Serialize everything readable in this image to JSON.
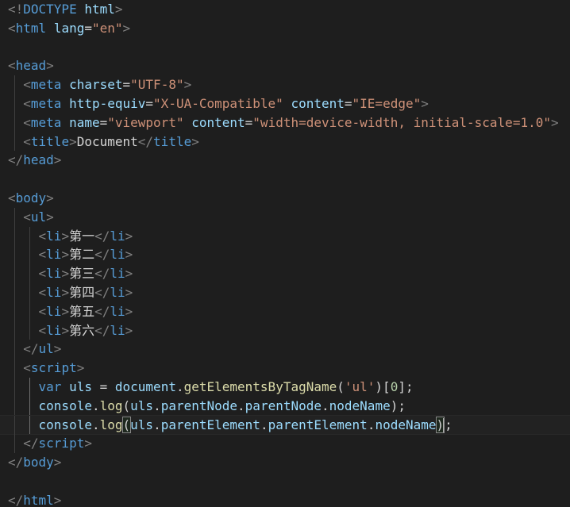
{
  "editor": {
    "lines": [
      [
        {
          "c": "t-punc",
          "t": "<!"
        },
        {
          "c": "t-tag",
          "t": "DOCTYPE "
        },
        {
          "c": "t-attr",
          "t": "html"
        },
        {
          "c": "t-punc",
          "t": ">"
        }
      ],
      [
        {
          "c": "t-punc",
          "t": "<"
        },
        {
          "c": "t-tag",
          "t": "html "
        },
        {
          "c": "t-attr",
          "t": "lang"
        },
        {
          "c": "t-text",
          "t": "="
        },
        {
          "c": "t-str",
          "t": "\"en\""
        },
        {
          "c": "t-punc",
          "t": ">"
        }
      ],
      [],
      [
        {
          "c": "t-punc",
          "t": "<"
        },
        {
          "c": "t-tag",
          "t": "head"
        },
        {
          "c": "t-punc",
          "t": ">"
        }
      ],
      [
        {
          "c": "t-text",
          "t": "  "
        },
        {
          "c": "t-punc",
          "t": "<"
        },
        {
          "c": "t-tag",
          "t": "meta "
        },
        {
          "c": "t-attr",
          "t": "charset"
        },
        {
          "c": "t-text",
          "t": "="
        },
        {
          "c": "t-str",
          "t": "\"UTF-8\""
        },
        {
          "c": "t-punc",
          "t": ">"
        }
      ],
      [
        {
          "c": "t-text",
          "t": "  "
        },
        {
          "c": "t-punc",
          "t": "<"
        },
        {
          "c": "t-tag",
          "t": "meta "
        },
        {
          "c": "t-attr",
          "t": "http-equiv"
        },
        {
          "c": "t-text",
          "t": "="
        },
        {
          "c": "t-str",
          "t": "\"X-UA-Compatible\""
        },
        {
          "c": "t-text",
          "t": " "
        },
        {
          "c": "t-attr",
          "t": "content"
        },
        {
          "c": "t-text",
          "t": "="
        },
        {
          "c": "t-str",
          "t": "\"IE=edge\""
        },
        {
          "c": "t-punc",
          "t": ">"
        }
      ],
      [
        {
          "c": "t-text",
          "t": "  "
        },
        {
          "c": "t-punc",
          "t": "<"
        },
        {
          "c": "t-tag",
          "t": "meta "
        },
        {
          "c": "t-attr",
          "t": "name"
        },
        {
          "c": "t-text",
          "t": "="
        },
        {
          "c": "t-str",
          "t": "\"viewport\""
        },
        {
          "c": "t-text",
          "t": " "
        },
        {
          "c": "t-attr",
          "t": "content"
        },
        {
          "c": "t-text",
          "t": "="
        },
        {
          "c": "t-str",
          "t": "\"width=device-width, initial-scale=1.0\""
        },
        {
          "c": "t-punc",
          "t": ">"
        }
      ],
      [
        {
          "c": "t-text",
          "t": "  "
        },
        {
          "c": "t-punc",
          "t": "<"
        },
        {
          "c": "t-tag",
          "t": "title"
        },
        {
          "c": "t-punc",
          "t": ">"
        },
        {
          "c": "t-text",
          "t": "Document"
        },
        {
          "c": "t-punc",
          "t": "</"
        },
        {
          "c": "t-tag",
          "t": "title"
        },
        {
          "c": "t-punc",
          "t": ">"
        }
      ],
      [
        {
          "c": "t-punc",
          "t": "</"
        },
        {
          "c": "t-tag",
          "t": "head"
        },
        {
          "c": "t-punc",
          "t": ">"
        }
      ],
      [],
      [
        {
          "c": "t-punc",
          "t": "<"
        },
        {
          "c": "t-tag",
          "t": "body"
        },
        {
          "c": "t-punc",
          "t": ">"
        }
      ],
      [
        {
          "c": "t-text",
          "t": "  "
        },
        {
          "c": "t-punc",
          "t": "<"
        },
        {
          "c": "t-tag",
          "t": "ul"
        },
        {
          "c": "t-punc",
          "t": ">"
        }
      ],
      [
        {
          "c": "t-text",
          "t": "    "
        },
        {
          "c": "t-punc",
          "t": "<"
        },
        {
          "c": "t-tag",
          "t": "li"
        },
        {
          "c": "t-punc",
          "t": ">"
        },
        {
          "c": "t-text",
          "t": "第一"
        },
        {
          "c": "t-punc",
          "t": "</"
        },
        {
          "c": "t-tag",
          "t": "li"
        },
        {
          "c": "t-punc",
          "t": ">"
        }
      ],
      [
        {
          "c": "t-text",
          "t": "    "
        },
        {
          "c": "t-punc",
          "t": "<"
        },
        {
          "c": "t-tag",
          "t": "li"
        },
        {
          "c": "t-punc",
          "t": ">"
        },
        {
          "c": "t-text",
          "t": "第二"
        },
        {
          "c": "t-punc",
          "t": "</"
        },
        {
          "c": "t-tag",
          "t": "li"
        },
        {
          "c": "t-punc",
          "t": ">"
        }
      ],
      [
        {
          "c": "t-text",
          "t": "    "
        },
        {
          "c": "t-punc",
          "t": "<"
        },
        {
          "c": "t-tag",
          "t": "li"
        },
        {
          "c": "t-punc",
          "t": ">"
        },
        {
          "c": "t-text",
          "t": "第三"
        },
        {
          "c": "t-punc",
          "t": "</"
        },
        {
          "c": "t-tag",
          "t": "li"
        },
        {
          "c": "t-punc",
          "t": ">"
        }
      ],
      [
        {
          "c": "t-text",
          "t": "    "
        },
        {
          "c": "t-punc",
          "t": "<"
        },
        {
          "c": "t-tag",
          "t": "li"
        },
        {
          "c": "t-punc",
          "t": ">"
        },
        {
          "c": "t-text",
          "t": "第四"
        },
        {
          "c": "t-punc",
          "t": "</"
        },
        {
          "c": "t-tag",
          "t": "li"
        },
        {
          "c": "t-punc",
          "t": ">"
        }
      ],
      [
        {
          "c": "t-text",
          "t": "    "
        },
        {
          "c": "t-punc",
          "t": "<"
        },
        {
          "c": "t-tag",
          "t": "li"
        },
        {
          "c": "t-punc",
          "t": ">"
        },
        {
          "c": "t-text",
          "t": "第五"
        },
        {
          "c": "t-punc",
          "t": "</"
        },
        {
          "c": "t-tag",
          "t": "li"
        },
        {
          "c": "t-punc",
          "t": ">"
        }
      ],
      [
        {
          "c": "t-text",
          "t": "    "
        },
        {
          "c": "t-punc",
          "t": "<"
        },
        {
          "c": "t-tag",
          "t": "li"
        },
        {
          "c": "t-punc",
          "t": ">"
        },
        {
          "c": "t-text",
          "t": "第六"
        },
        {
          "c": "t-punc",
          "t": "</"
        },
        {
          "c": "t-tag",
          "t": "li"
        },
        {
          "c": "t-punc",
          "t": ">"
        }
      ],
      [
        {
          "c": "t-text",
          "t": "  "
        },
        {
          "c": "t-punc",
          "t": "</"
        },
        {
          "c": "t-tag",
          "t": "ul"
        },
        {
          "c": "t-punc",
          "t": ">"
        }
      ],
      [
        {
          "c": "t-text",
          "t": "  "
        },
        {
          "c": "t-punc",
          "t": "<"
        },
        {
          "c": "t-tag",
          "t": "script"
        },
        {
          "c": "t-punc",
          "t": ">"
        }
      ],
      [
        {
          "c": "t-text",
          "t": "    "
        },
        {
          "c": "t-kw",
          "t": "var"
        },
        {
          "c": "t-text",
          "t": " "
        },
        {
          "c": "t-var",
          "t": "uls"
        },
        {
          "c": "t-op",
          "t": " = "
        },
        {
          "c": "t-var",
          "t": "document"
        },
        {
          "c": "t-text",
          "t": "."
        },
        {
          "c": "t-fn",
          "t": "getElementsByTagName"
        },
        {
          "c": "t-text",
          "t": "("
        },
        {
          "c": "t-str",
          "t": "'ul'"
        },
        {
          "c": "t-text",
          "t": ")["
        },
        {
          "c": "t-num",
          "t": "0"
        },
        {
          "c": "t-text",
          "t": "];"
        }
      ],
      [
        {
          "c": "t-text",
          "t": "    "
        },
        {
          "c": "t-var",
          "t": "console"
        },
        {
          "c": "t-text",
          "t": "."
        },
        {
          "c": "t-fn",
          "t": "log"
        },
        {
          "c": "t-text",
          "t": "("
        },
        {
          "c": "t-var",
          "t": "uls"
        },
        {
          "c": "t-text",
          "t": "."
        },
        {
          "c": "t-var",
          "t": "parentNode"
        },
        {
          "c": "t-text",
          "t": "."
        },
        {
          "c": "t-var",
          "t": "parentNode"
        },
        {
          "c": "t-text",
          "t": "."
        },
        {
          "c": "t-var",
          "t": "nodeName"
        },
        {
          "c": "t-text",
          "t": ");"
        }
      ],
      [
        {
          "c": "t-text",
          "t": "    "
        },
        {
          "c": "t-var",
          "t": "console"
        },
        {
          "c": "t-text",
          "t": "."
        },
        {
          "c": "t-fn",
          "t": "log"
        },
        {
          "c": "t-text bracket-match",
          "t": "("
        },
        {
          "c": "t-var",
          "t": "uls"
        },
        {
          "c": "t-text",
          "t": "."
        },
        {
          "c": "t-var",
          "t": "parentElement"
        },
        {
          "c": "t-text",
          "t": "."
        },
        {
          "c": "t-var",
          "t": "parentElement"
        },
        {
          "c": "t-text",
          "t": "."
        },
        {
          "c": "t-var",
          "t": "nodeName"
        },
        {
          "c": "t-text bracket-match",
          "t": ")"
        },
        {
          "c": "cursor",
          "t": ""
        },
        {
          "c": "t-text",
          "t": ";"
        }
      ],
      [
        {
          "c": "t-text",
          "t": "  "
        },
        {
          "c": "t-punc",
          "t": "</"
        },
        {
          "c": "t-tag",
          "t": "script"
        },
        {
          "c": "t-punc",
          "t": ">"
        }
      ],
      [
        {
          "c": "t-punc",
          "t": "</"
        },
        {
          "c": "t-tag",
          "t": "body"
        },
        {
          "c": "t-punc",
          "t": ">"
        }
      ],
      [],
      [
        {
          "c": "t-punc",
          "t": "</"
        },
        {
          "c": "t-tag",
          "t": "html"
        },
        {
          "c": "t-punc",
          "t": ">"
        }
      ]
    ],
    "current_line": 22,
    "colors": {
      "background": "#1e1e1e",
      "tag": "#569cd6",
      "attribute": "#9cdcfe",
      "string": "#ce9178",
      "function": "#dcdcaa",
      "number": "#b5cea8",
      "punctuation": "#808080",
      "text": "#d4d4d4"
    }
  }
}
